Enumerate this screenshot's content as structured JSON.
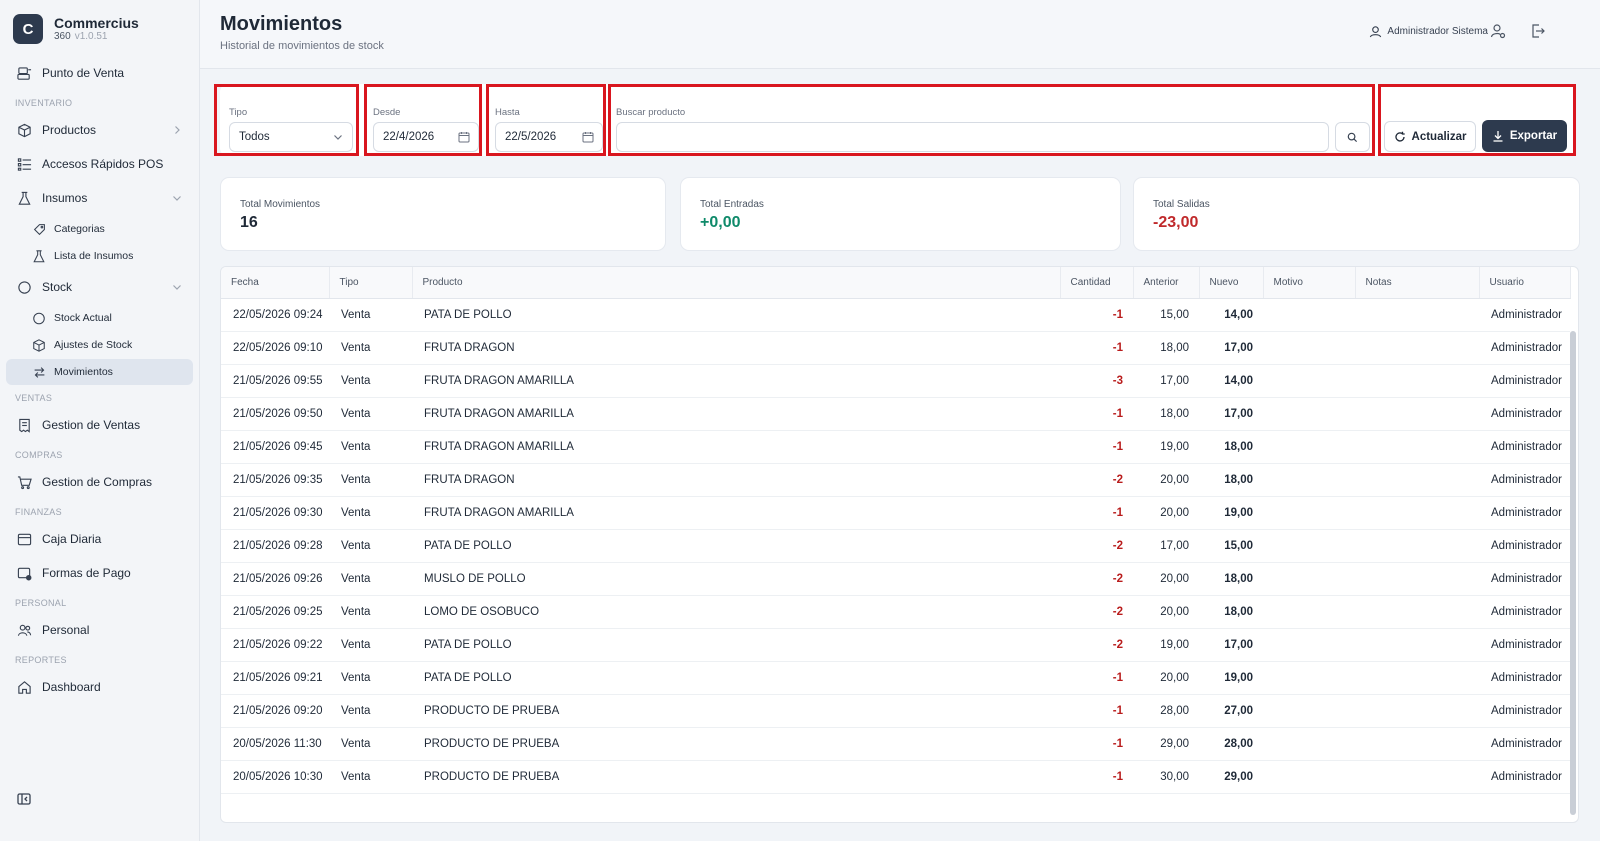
{
  "brand": {
    "logo_letter": "C",
    "name": "Commercius",
    "sub": "360",
    "version": "v1.0.51"
  },
  "sidebar": {
    "items": [
      {
        "label": "Punto de Venta",
        "icon": "pos-icon"
      },
      {
        "section": "INVENTARIO"
      },
      {
        "label": "Productos",
        "icon": "box-icon",
        "chevron": "right"
      },
      {
        "label": "Accesos Rápidos POS",
        "icon": "list-icon"
      },
      {
        "label": "Insumos",
        "icon": "flask-icon",
        "chevron": "down"
      },
      {
        "label": "Categorias",
        "icon": "tag-icon",
        "sub": true
      },
      {
        "label": "Lista de Insumos",
        "icon": "flask-icon",
        "sub": true
      },
      {
        "label": "Stock",
        "icon": "circle-icon",
        "chevron": "down"
      },
      {
        "label": "Stock Actual",
        "icon": "circle-icon",
        "sub": true
      },
      {
        "label": "Ajustes de Stock",
        "icon": "box-icon",
        "sub": true
      },
      {
        "label": "Movimientos",
        "icon": "arrows-icon",
        "sub": true,
        "active": true
      },
      {
        "section": "VENTAS"
      },
      {
        "label": "Gestion de Ventas",
        "icon": "receipt-icon"
      },
      {
        "section": "COMPRAS"
      },
      {
        "label": "Gestion de Compras",
        "icon": "cart-icon"
      },
      {
        "section": "FINANZAS"
      },
      {
        "label": "Caja Diaria",
        "icon": "cash-icon"
      },
      {
        "label": "Formas de Pago",
        "icon": "card-icon"
      },
      {
        "section": "PERSONAL"
      },
      {
        "label": "Personal",
        "icon": "users-icon"
      },
      {
        "section": "REPORTES"
      },
      {
        "label": "Dashboard",
        "icon": "home-icon"
      }
    ]
  },
  "header": {
    "title": "Movimientos",
    "subtitle": "Historial de movimientos de stock",
    "user": "Administrador Sistema"
  },
  "filters": {
    "tipo_label": "Tipo",
    "tipo_value": "Todos",
    "desde_label": "Desde",
    "desde_value": "22/4/2026",
    "hasta_label": "Hasta",
    "hasta_value": "22/5/2026",
    "buscar_label": "Buscar producto",
    "buscar_value": "",
    "refresh_label": "Actualizar",
    "export_label": "Exportar"
  },
  "stats": [
    {
      "label": "Total Movimientos",
      "value": "16",
      "color": "#1f2937"
    },
    {
      "label": "Total Entradas",
      "value": "+0,00",
      "color": "#0f8a6a"
    },
    {
      "label": "Total Salidas",
      "value": "-23,00",
      "color": "#c0292b"
    }
  ],
  "table": {
    "columns": [
      "Fecha",
      "Tipo",
      "Producto",
      "Cantidad",
      "Anterior",
      "Nuevo",
      "Motivo",
      "Notas",
      "Usuario"
    ],
    "rows": [
      [
        "22/05/2026 09:24",
        "Venta",
        "PATA DE POLLO",
        "-1",
        "15,00",
        "14,00",
        "",
        "",
        "Administrador"
      ],
      [
        "22/05/2026 09:10",
        "Venta",
        "FRUTA DRAGON",
        "-1",
        "18,00",
        "17,00",
        "",
        "",
        "Administrador"
      ],
      [
        "21/05/2026 09:55",
        "Venta",
        "FRUTA DRAGON AMARILLA",
        "-3",
        "17,00",
        "14,00",
        "",
        "",
        "Administrador"
      ],
      [
        "21/05/2026 09:50",
        "Venta",
        "FRUTA DRAGON AMARILLA",
        "-1",
        "18,00",
        "17,00",
        "",
        "",
        "Administrador"
      ],
      [
        "21/05/2026 09:45",
        "Venta",
        "FRUTA DRAGON AMARILLA",
        "-1",
        "19,00",
        "18,00",
        "",
        "",
        "Administrador"
      ],
      [
        "21/05/2026 09:35",
        "Venta",
        "FRUTA DRAGON",
        "-2",
        "20,00",
        "18,00",
        "",
        "",
        "Administrador"
      ],
      [
        "21/05/2026 09:30",
        "Venta",
        "FRUTA DRAGON AMARILLA",
        "-1",
        "20,00",
        "19,00",
        "",
        "",
        "Administrador"
      ],
      [
        "21/05/2026 09:28",
        "Venta",
        "PATA DE POLLO",
        "-2",
        "17,00",
        "15,00",
        "",
        "",
        "Administrador"
      ],
      [
        "21/05/2026 09:26",
        "Venta",
        "MUSLO DE POLLO",
        "-2",
        "20,00",
        "18,00",
        "",
        "",
        "Administrador"
      ],
      [
        "21/05/2026 09:25",
        "Venta",
        "LOMO DE OSOBUCO",
        "-2",
        "20,00",
        "18,00",
        "",
        "",
        "Administrador"
      ],
      [
        "21/05/2026 09:22",
        "Venta",
        "PATA DE POLLO",
        "-2",
        "19,00",
        "17,00",
        "",
        "",
        "Administrador"
      ],
      [
        "21/05/2026 09:21",
        "Venta",
        "PATA DE POLLO",
        "-1",
        "20,00",
        "19,00",
        "",
        "",
        "Administrador"
      ],
      [
        "21/05/2026 09:20",
        "Venta",
        "PRODUCTO DE PRUEBA",
        "-1",
        "28,00",
        "27,00",
        "",
        "",
        "Administrador"
      ],
      [
        "20/05/2026 11:30",
        "Venta",
        "PRODUCTO DE PRUEBA",
        "-1",
        "29,00",
        "28,00",
        "",
        "",
        "Administrador"
      ],
      [
        "20/05/2026 10:30",
        "Venta",
        "PRODUCTO DE PRUEBA",
        "-1",
        "30,00",
        "29,00",
        "",
        "",
        "Administrador"
      ]
    ]
  }
}
